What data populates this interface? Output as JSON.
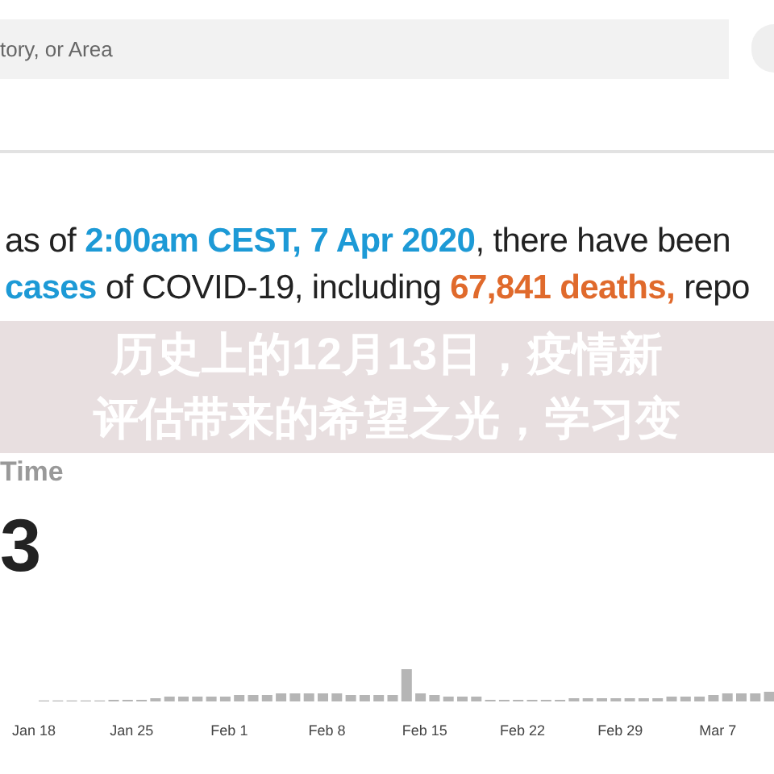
{
  "search": {
    "placeholder": "tory, or Area"
  },
  "summary_lines": [
    [
      {
        "text": "as of ",
        "kind": "plain"
      },
      {
        "text": "2:00am CEST, 7 Apr 2020",
        "kind": "date"
      },
      {
        "text": ", there have been",
        "kind": "plain"
      }
    ],
    [
      {
        "text": "cases",
        "kind": "date"
      },
      {
        "text": " of COVID-19, including ",
        "kind": "plain"
      },
      {
        "text": "67,841 deaths,",
        "kind": "deaths"
      },
      {
        "text": " repo",
        "kind": "plain"
      }
    ]
  ],
  "overlay_banner": {
    "lines": [
      "历史上的12月13日，疫情新",
      "评估带来的希望之光，学习变"
    ]
  },
  "section_title": "Time",
  "big_number": "3",
  "chart": {
    "axis_labels": [
      "Jan 18",
      "Jan 25",
      "Feb 1",
      "Feb 8",
      "Feb 15",
      "Feb 22",
      "Feb 29",
      "Mar 7"
    ]
  }
}
